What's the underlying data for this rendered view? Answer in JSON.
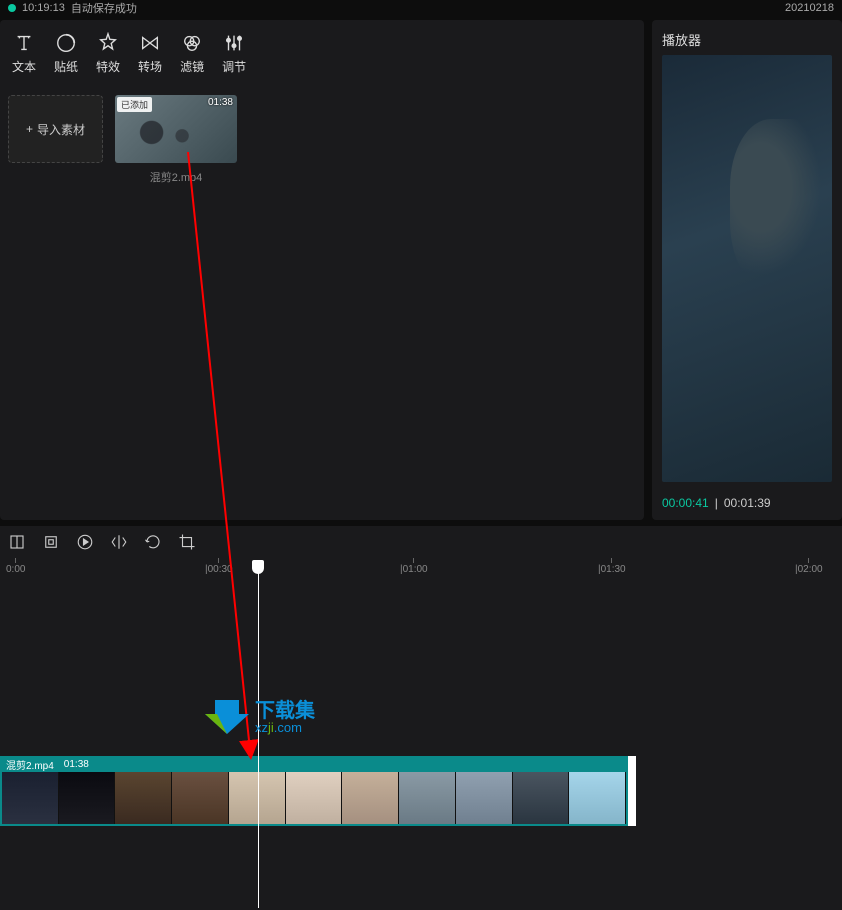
{
  "topbar": {
    "time": "10:19:13",
    "status": "自动保存成功",
    "date": "20210218"
  },
  "tabs": {
    "text": "文本",
    "sticker": "贴纸",
    "effect": "特效",
    "transition": "转场",
    "filter": "滤镜",
    "adjust": "调节"
  },
  "import": {
    "label": "导入素材"
  },
  "clip": {
    "badge": "已添加",
    "duration": "01:38",
    "name": "混剪2.mp4"
  },
  "player": {
    "title": "播放器",
    "current": "00:00:41",
    "total": "00:01:39"
  },
  "ruler": {
    "t0": "0:00",
    "t1": "|00:30",
    "t2": "|01:00",
    "t3": "|01:30",
    "t4": "|02:00"
  },
  "track": {
    "name": "混剪2.mp4",
    "duration": "01:38"
  },
  "watermark": {
    "cn": "下载集",
    "en_pre": "xz",
    "en_g": "ji",
    "en_post": ".com"
  }
}
